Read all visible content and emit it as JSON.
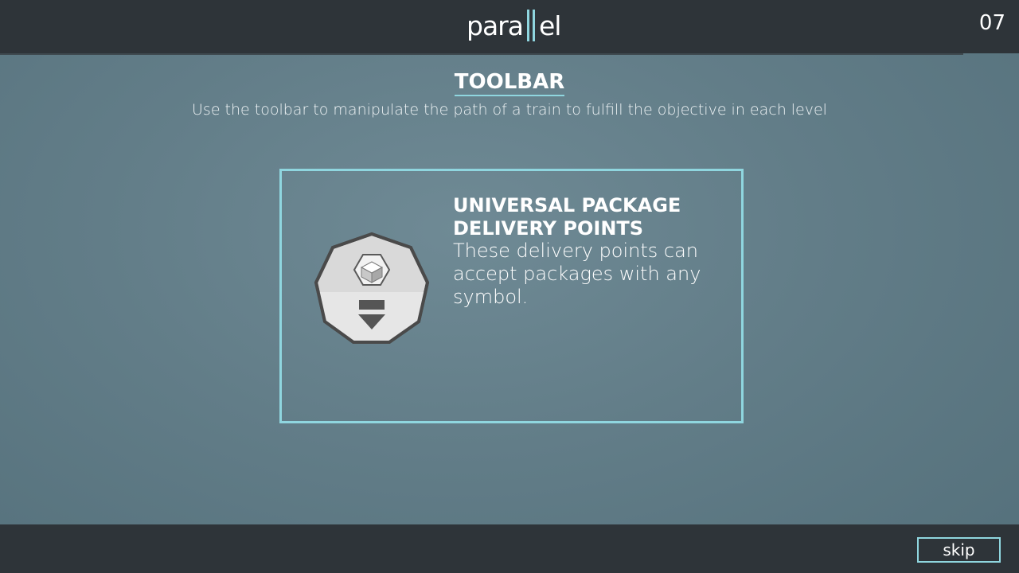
{
  "header": {
    "logo_text_left": "para",
    "logo_text_right": "el",
    "level_number": "07"
  },
  "tutorial": {
    "title": "TOOLBAR",
    "subtitle": "Use the toolbar to manipulate the path of a train to fulfill the objective in each level"
  },
  "card": {
    "icon": "universal-delivery-point-icon",
    "heading": "UNIVERSAL PACKAGE DELIVERY POINTS",
    "description": "These delivery points can accept packages with any symbol."
  },
  "footer": {
    "skip_label": "skip"
  },
  "colors": {
    "accent": "#8fd6df",
    "bar_background": "#2e3439",
    "page_background": "#627d88"
  }
}
